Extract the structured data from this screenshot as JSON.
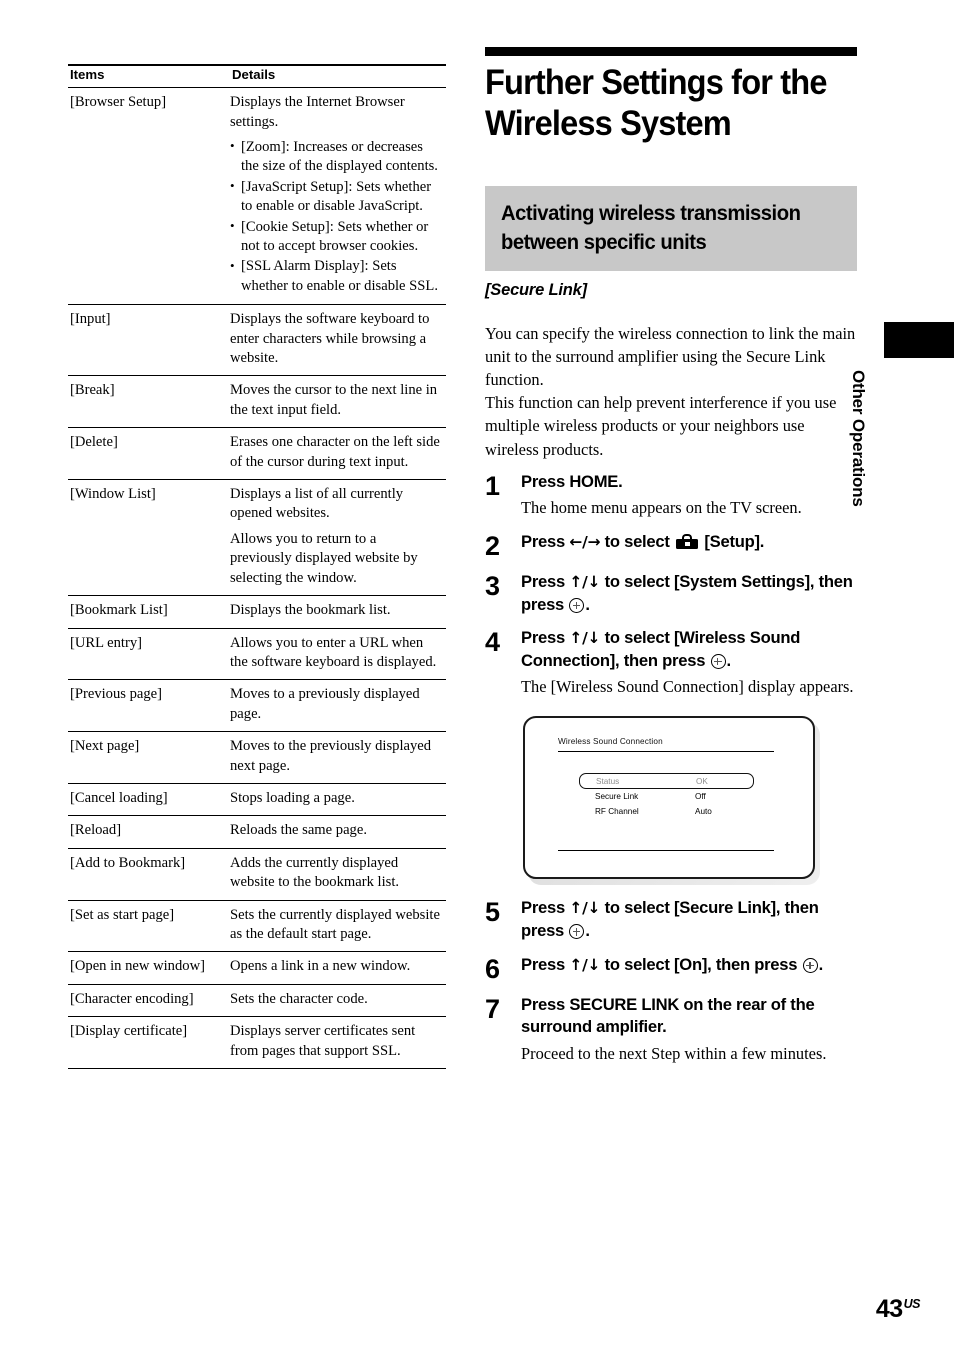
{
  "table": {
    "headers": {
      "items": "Items",
      "details": "Details"
    },
    "rows": [
      {
        "item": "[Browser Setup]",
        "paragraphs": [
          "Displays the Internet Browser settings."
        ],
        "bullets": [
          "[Zoom]: Increases or decreases the size of the displayed contents.",
          "[JavaScript Setup]: Sets whether to enable or disable JavaScript.",
          "[Cookie Setup]: Sets whether or not to accept browser cookies.",
          "[SSL Alarm Display]: Sets whether to enable or disable SSL."
        ]
      },
      {
        "item": "[Input]",
        "paragraphs": [
          "Displays the software keyboard to enter characters while browsing a website."
        ],
        "bullets": []
      },
      {
        "item": "[Break]",
        "paragraphs": [
          "Moves the cursor to the next line in the text input field."
        ],
        "bullets": []
      },
      {
        "item": "[Delete]",
        "paragraphs": [
          "Erases one character on the left side of the cursor during text input."
        ],
        "bullets": []
      },
      {
        "item": "[Window List]",
        "paragraphs": [
          "Displays a list of all currently opened websites.",
          "Allows you to return to a previously displayed website by selecting the window."
        ],
        "bullets": []
      },
      {
        "item": "[Bookmark List]",
        "paragraphs": [
          "Displays the bookmark list."
        ],
        "bullets": []
      },
      {
        "item": "[URL entry]",
        "paragraphs": [
          "Allows you to enter a URL when the software keyboard is displayed."
        ],
        "bullets": []
      },
      {
        "item": "[Previous page]",
        "paragraphs": [
          "Moves to a previously displayed page."
        ],
        "bullets": []
      },
      {
        "item": "[Next page]",
        "paragraphs": [
          "Moves to the previously displayed next page."
        ],
        "bullets": []
      },
      {
        "item": "[Cancel loading]",
        "paragraphs": [
          "Stops loading a page."
        ],
        "bullets": []
      },
      {
        "item": "[Reload]",
        "paragraphs": [
          "Reloads the same page."
        ],
        "bullets": []
      },
      {
        "item": "[Add to Bookmark]",
        "paragraphs": [
          "Adds the currently displayed website to the bookmark list."
        ],
        "bullets": []
      },
      {
        "item": "[Set as start page]",
        "paragraphs": [
          "Sets the currently displayed website as the default start page."
        ],
        "bullets": []
      },
      {
        "item": "[Open in new window]",
        "paragraphs": [
          "Opens a link in a new window."
        ],
        "bullets": []
      },
      {
        "item": "[Character encoding]",
        "paragraphs": [
          "Sets the character code."
        ],
        "bullets": []
      },
      {
        "item": "[Display certificate]",
        "paragraphs": [
          "Displays server certificates sent from pages that support SSL."
        ],
        "bullets": []
      }
    ]
  },
  "article": {
    "title": "Further Settings for the Wireless System",
    "section_heading": "Activating wireless transmission between specific units",
    "section_label": "[Secure Link]",
    "intro": [
      "You can specify the wireless connection to link the main unit to the surround amplifier using the Secure Link function.",
      "This function can help prevent interference if you use multiple wireless products or your neighbors use wireless products."
    ]
  },
  "steps": [
    {
      "num": "1",
      "head_parts": [
        "Press HOME."
      ],
      "note": "The home menu appears on the TV screen."
    },
    {
      "num": "2",
      "head_before": "Press ",
      "arrows": "←/→",
      "head_mid": " to select ",
      "head_after": " [Setup].",
      "note": ""
    },
    {
      "num": "3",
      "head_before": "Press ",
      "arrows": "↑/↓",
      "head_mid": " to select [System Settings], then press ",
      "head_after": ".",
      "note": ""
    },
    {
      "num": "4",
      "head_before": "Press ",
      "arrows": "↑/↓",
      "head_mid": " to select [Wireless Sound Connection], then press ",
      "head_after": ".",
      "note": "The [Wireless Sound Connection] display appears."
    },
    {
      "num": "5",
      "head_before": "Press ",
      "arrows": "↑/↓",
      "head_mid": " to select [Secure Link], then press ",
      "head_after": ".",
      "note": ""
    },
    {
      "num": "6",
      "head_before": "Press ",
      "arrows": "↑/↓",
      "head_mid": " to select [On], then press ",
      "head_after": ".",
      "note": ""
    },
    {
      "num": "7",
      "head_parts": [
        "Press SECURE LINK on the rear of the surround amplifier."
      ],
      "note": "Proceed to the next Step within a few minutes."
    }
  ],
  "tv_display": {
    "title": "Wireless Sound Connection",
    "rows": [
      {
        "key": "Status",
        "value": "OK",
        "selected": true
      },
      {
        "key": "Secure Link",
        "value": "Off",
        "selected": false
      },
      {
        "key": "RF Channel",
        "value": "Auto",
        "selected": false
      }
    ]
  },
  "margin": {
    "tab_label": "Other Operations"
  },
  "footer": {
    "page_number": "43",
    "region": "US"
  },
  "colors": {
    "gray_heading_bg": "#c8c8c8",
    "rule": "#000000",
    "tv_selected_text": "#8e8e8e"
  }
}
